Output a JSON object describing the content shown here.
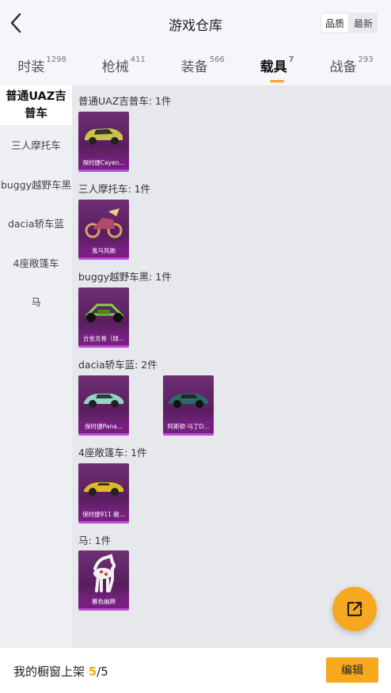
{
  "header": {
    "title": "游戏仓库",
    "sort_options": [
      "品质",
      "最新"
    ],
    "sort_selected": "品质"
  },
  "tabs": [
    {
      "label": "时装",
      "count": "1298"
    },
    {
      "label": "枪械",
      "count": "411"
    },
    {
      "label": "装备",
      "count": "566"
    },
    {
      "label": "载具",
      "count": "7",
      "active": true
    },
    {
      "label": "战备",
      "count": "293"
    }
  ],
  "sidebar": {
    "active": "普通UAZ吉普车",
    "items": [
      "三人摩托车",
      "buggy越野车黑",
      "dacia轿车蓝",
      "4座敞篷车",
      "马"
    ]
  },
  "groups": [
    {
      "title": "普通UAZ吉普车: 1件",
      "items": [
        {
          "label": "保时捷Cayen...",
          "icon": "car-icon",
          "color": "#c9c24a"
        }
      ]
    },
    {
      "title": "三人摩托车: 1件",
      "items": [
        {
          "label": "鬼马风驰",
          "icon": "motorcycle-icon",
          "color": "#d9a06a"
        }
      ]
    },
    {
      "title": "buggy越野车黑: 1件",
      "items": [
        {
          "label": "合金龙骨（绿...",
          "icon": "buggy-icon",
          "color": "#7ed63a"
        }
      ]
    },
    {
      "title": "dacia轿车蓝: 2件",
      "items": [
        {
          "label": "保时捷Pana...",
          "icon": "car-icon",
          "color": "#8fd6c8"
        },
        {
          "label": "阿斯顿·马丁D...",
          "icon": "car-icon",
          "color": "#2b6a66"
        }
      ]
    },
    {
      "title": "4座敞篷车: 1件",
      "items": [
        {
          "label": "保时捷911 敞...",
          "icon": "car-icon",
          "color": "#e0b82a"
        }
      ]
    },
    {
      "title": "马: 1件",
      "items": [
        {
          "label": "暮色幽蹄",
          "icon": "horse-icon",
          "color": "#f0f0f0"
        }
      ]
    }
  ],
  "footer": {
    "label": "我的橱窗上架",
    "current": "5",
    "separator": "/",
    "total": "5",
    "edit_label": "编辑"
  },
  "colors": {
    "accent": "#f6a91f",
    "card": "#6e2f73"
  }
}
